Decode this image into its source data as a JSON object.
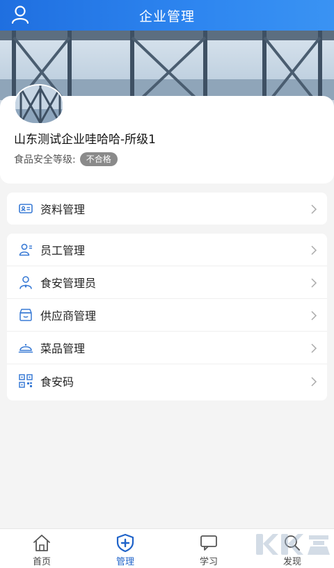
{
  "header": {
    "title": "企业管理",
    "user_icon": "user-icon"
  },
  "profile": {
    "company_name": "山东测试企业哇哈哈-所级1",
    "rating_label": "食品安全等级:",
    "rating_value": "不合格"
  },
  "menu_group1": [
    {
      "label": "资料管理",
      "icon": "id-card-icon"
    }
  ],
  "menu_group2": [
    {
      "label": "员工管理",
      "icon": "staff-icon"
    },
    {
      "label": "食安管理员",
      "icon": "admin-person-icon"
    },
    {
      "label": "供应商管理",
      "icon": "store-icon"
    },
    {
      "label": "菜品管理",
      "icon": "dish-cover-icon"
    },
    {
      "label": "食安码",
      "icon": "qr-code-icon"
    }
  ],
  "tabs": [
    {
      "label": "首页",
      "icon": "home-icon",
      "active": false
    },
    {
      "label": "管理",
      "icon": "shield-plus-icon",
      "active": true
    },
    {
      "label": "学习",
      "icon": "chat-bubble-icon",
      "active": false
    },
    {
      "label": "发现",
      "icon": "search-icon",
      "active": false
    }
  ],
  "colors": {
    "brand": "#2578e8",
    "active_tab": "#1f63c9",
    "icon_blue": "#3a7bd5",
    "badge": "#8a8a8a"
  }
}
